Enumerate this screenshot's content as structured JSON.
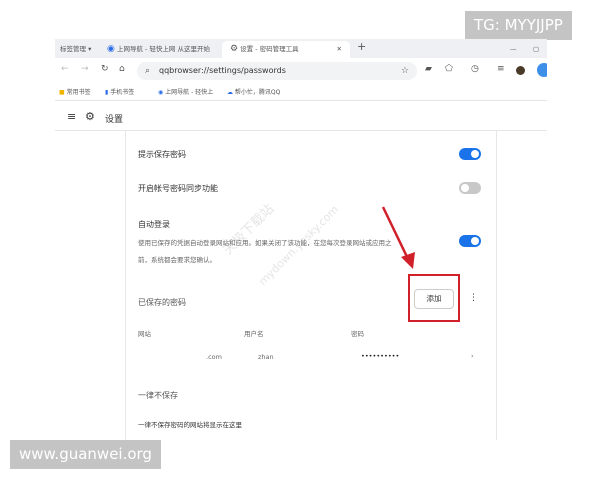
{
  "tabs": [
    {
      "label": "标签管理 ▾"
    },
    {
      "label": "上网导航 - 轻快上网 从这里开始"
    },
    {
      "label": "设置 - 密码管理工具",
      "active": true
    }
  ],
  "address": {
    "url": "qqbrowser://settings/passwords"
  },
  "bookmarks": [
    {
      "label": "常用书签"
    },
    {
      "label": "手机书签"
    },
    {
      "label": "上网导航 - 轻快上"
    },
    {
      "label": "帮小忙，腾讯QQ"
    }
  ],
  "header": {
    "title": "设置"
  },
  "settings": {
    "offer_save": {
      "label": "提示保存密码",
      "enabled": true
    },
    "sync": {
      "label": "开启帐号密码同步功能",
      "enabled": false
    },
    "auto_login": {
      "label": "自动登录",
      "desc1": "使用已保存的凭据自动登录网站和应用。如果关闭了该功能，在您每次登录网站或应用之",
      "desc2": "前，系统都会要求您确认。",
      "enabled": true
    }
  },
  "saved": {
    "title": "已保存的密码",
    "add_label": "添加",
    "columns": [
      "网站",
      "用户名",
      "密码"
    ],
    "rows": [
      {
        "site": ".com",
        "username": "zhan",
        "password": "••••••••••"
      }
    ]
  },
  "never": {
    "title": "一律不保存",
    "empty": "一律不保存密码的网站将显示在这里"
  },
  "watermarks": {
    "top": "TG: MYYJJPP",
    "bottom": "www.guanwei.org",
    "diag1": "天极下载站",
    "diag2": "mydown.yesky.com"
  },
  "colors": {
    "accent": "#1a73e8",
    "highlight": "#d0202a"
  }
}
